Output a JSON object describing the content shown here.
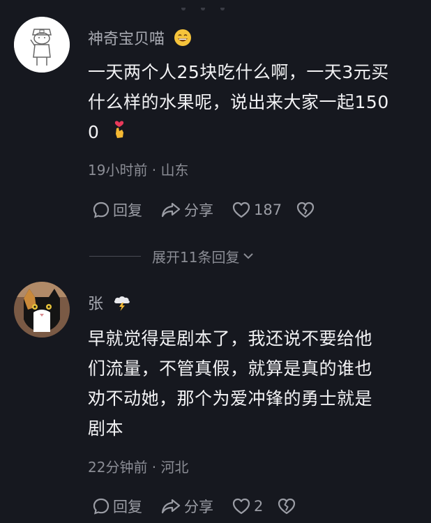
{
  "comments": [
    {
      "username": "神奇宝贝喵",
      "text_lines": [
        "一天两个人25块吃什么啊，一天3元买",
        "什么样的水果呢，说出来大家一起150",
        "0"
      ],
      "meta": "19小时前 · 山东",
      "reply_label": "回复",
      "share_label": "分享",
      "likes": "187",
      "icons": {
        "username_emoji": "grinning-face-icon",
        "text_emoji": "heart-hand-icon"
      }
    },
    {
      "username": "张",
      "text_lines": [
        "早就觉得是剧本了，我还说不要给他",
        "们流量，不管真假，就算是真的谁也",
        "劝不动她，那个为爱冲锋的勇士就是",
        "剧本"
      ],
      "meta": "22分钟前 · 河北",
      "reply_label": "回复",
      "share_label": "分享",
      "likes": "2",
      "icons": {
        "username_emoji": "lightning-cloud-icon"
      }
    }
  ],
  "expand_replies": "展开11条回复",
  "colors": {
    "background": "#16181f",
    "text": "#f2f2f4",
    "muted": "#8b8d95"
  }
}
